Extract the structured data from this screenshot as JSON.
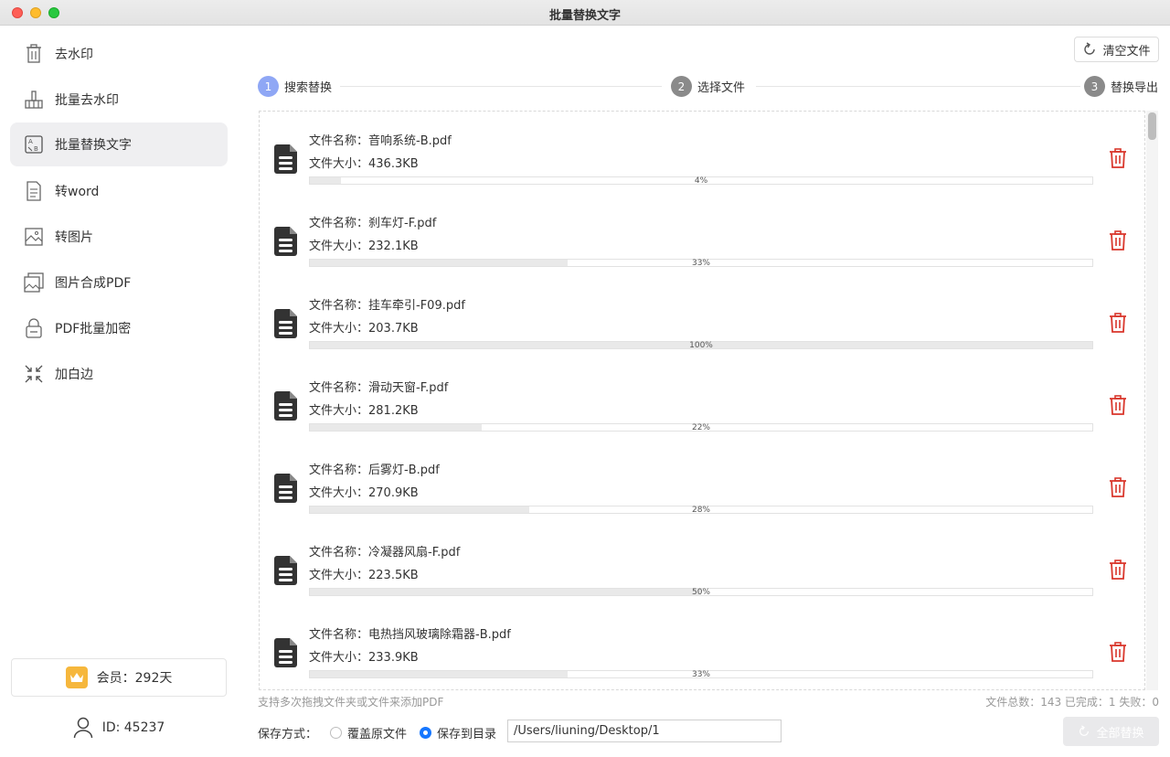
{
  "window": {
    "title": "批量替换文字"
  },
  "sidebar": {
    "items": [
      {
        "label": "去水印",
        "icon": "trash-doc-icon",
        "active": false
      },
      {
        "label": "批量去水印",
        "icon": "batch-erase-icon",
        "active": false
      },
      {
        "label": "批量替换文字",
        "icon": "text-replace-icon",
        "active": true
      },
      {
        "label": "转word",
        "icon": "document-icon",
        "active": false
      },
      {
        "label": "转图片",
        "icon": "image-icon",
        "active": false
      },
      {
        "label": "图片合成PDF",
        "icon": "images-merge-icon",
        "active": false
      },
      {
        "label": "PDF批量加密",
        "icon": "lock-icon",
        "active": false
      },
      {
        "label": "加白边",
        "icon": "shrink-arrows-icon",
        "active": false
      }
    ],
    "member_text": "会员：292天",
    "user_id": "ID: 45237"
  },
  "toolbar": {
    "clear_label": "清空文件"
  },
  "steps": [
    {
      "num": "1",
      "label": "搜索替换",
      "active": true
    },
    {
      "num": "2",
      "label": "选择文件",
      "active": false
    },
    {
      "num": "3",
      "label": "替换导出",
      "active": false
    }
  ],
  "files": [
    {
      "name": "文件名称：音响系统-B.pdf",
      "size": "文件大小：436.3KB",
      "progress": 4,
      "progress_label": "4%"
    },
    {
      "name": "文件名称：刹车灯-F.pdf",
      "size": "文件大小：232.1KB",
      "progress": 33,
      "progress_label": "33%"
    },
    {
      "name": "文件名称：挂车牵引-F09.pdf",
      "size": "文件大小：203.7KB",
      "progress": 100,
      "progress_label": "100%"
    },
    {
      "name": "文件名称：滑动天窗-F.pdf",
      "size": "文件大小：281.2KB",
      "progress": 22,
      "progress_label": "22%"
    },
    {
      "name": "文件名称：后雾灯-B.pdf",
      "size": "文件大小：270.9KB",
      "progress": 28,
      "progress_label": "28%"
    },
    {
      "name": "文件名称：冷凝器风扇-F.pdf",
      "size": "文件大小：223.5KB",
      "progress": 50,
      "progress_label": "50%"
    },
    {
      "name": "文件名称：电热挡风玻璃除霜器-B.pdf",
      "size": "文件大小：233.9KB",
      "progress": 33,
      "progress_label": "33%"
    }
  ],
  "footer": {
    "hint": "支持多次拖拽文件夹或文件来添加PDF",
    "stats": "文件总数：143 已完成：1 失败：0",
    "save_label": "保存方式：",
    "option_overwrite": "覆盖原文件",
    "option_directory": "保存到目录",
    "selected_option": "保存到目录",
    "path_value": "/Users/liuning/Desktop/1",
    "replace_all_label": "全部替换"
  },
  "colors": {
    "accent": "#1677ff",
    "step_active": "#8fa7f5",
    "step_inactive": "#8a8a8a",
    "delete": "#d9362b",
    "member_crown": "#f6b73c"
  }
}
